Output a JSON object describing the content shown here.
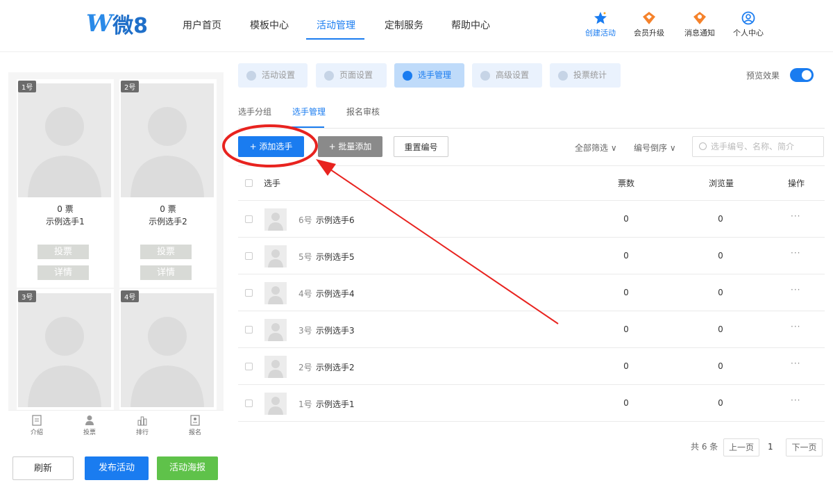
{
  "brand": {
    "logo_letter": "W",
    "logo_text": "微8"
  },
  "nav": {
    "items": [
      "用户首页",
      "模板中心",
      "活动管理",
      "定制服务",
      "帮助中心"
    ],
    "right": [
      "创建活动",
      "会员升级",
      "消息通知",
      "个人中心"
    ]
  },
  "preview": {
    "cards": [
      {
        "badge": "1号",
        "votes": "0 票",
        "name": "示例选手1",
        "vote_btn": "投票",
        "detail_btn": "详情"
      },
      {
        "badge": "2号",
        "votes": "0 票",
        "name": "示例选手2",
        "vote_btn": "投票",
        "detail_btn": "详情"
      },
      {
        "badge": "3号"
      },
      {
        "badge": "4号"
      }
    ],
    "bottom_tabs": [
      "介绍",
      "投票",
      "排行",
      "报名"
    ]
  },
  "left_actions": {
    "refresh": "刷新",
    "publish": "发布活动",
    "poster": "活动海报"
  },
  "settings_tabs": [
    "活动设置",
    "页面设置",
    "选手管理",
    "高级设置",
    "投票统计"
  ],
  "preview_toggle_label": "预览效果",
  "sub_tabs": [
    "选手分组",
    "选手管理",
    "报名审核"
  ],
  "actions": {
    "add": "+ 添加选手",
    "batch": "+ 批量添加",
    "renumber": "重置编号"
  },
  "filters": {
    "all": "全部筛选 ∨",
    "order": "编号倒序 ∨"
  },
  "search": {
    "placeholder": "选手编号、名称、简介"
  },
  "table": {
    "headers": {
      "player": "选手",
      "votes": "票数",
      "views": "浏览量",
      "ops": "操作"
    },
    "rows": [
      {
        "num": "6号",
        "name": "示例选手6",
        "votes": "0",
        "views": "0",
        "more": "···"
      },
      {
        "num": "5号",
        "name": "示例选手5",
        "votes": "0",
        "views": "0",
        "more": "···"
      },
      {
        "num": "4号",
        "name": "示例选手4",
        "votes": "0",
        "views": "0",
        "more": "···"
      },
      {
        "num": "3号",
        "name": "示例选手3",
        "votes": "0",
        "views": "0",
        "more": "···"
      },
      {
        "num": "2号",
        "name": "示例选手2",
        "votes": "0",
        "views": "0",
        "more": "···"
      },
      {
        "num": "1号",
        "name": "示例选手1",
        "votes": "0",
        "views": "0",
        "more": "···"
      }
    ]
  },
  "pagination": {
    "total": "共 6 条",
    "prev": "上一页",
    "page": "1",
    "next": "下一页"
  },
  "colors": {
    "primary": "#1a7cf0",
    "green": "#5fc24a",
    "annotation": "#e8231f"
  }
}
